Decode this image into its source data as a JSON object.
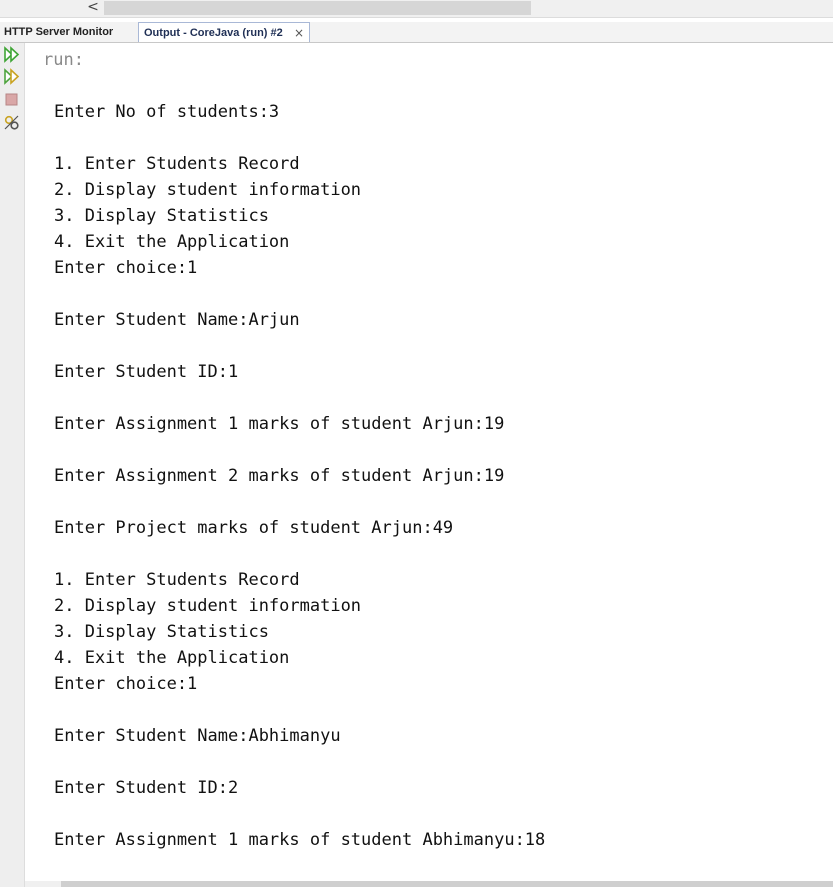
{
  "top_scrollbar": {
    "left_arrow": "<"
  },
  "tabs": [
    {
      "label": "HTTP Server Monitor",
      "active": false
    },
    {
      "label": "Output - CoreJava (run) #2",
      "active": true,
      "close": "×"
    }
  ],
  "toolbar": {
    "icons": [
      "rerun-icon",
      "rerun-with-options-icon",
      "stop-icon",
      "settings-icon"
    ]
  },
  "output": {
    "run_label": "run:",
    "lines": [
      "Enter No of students:3",
      "",
      "1. Enter Students Record",
      "2. Display student information",
      "3. Display Statistics",
      "4. Exit the Application",
      "Enter choice:1",
      "",
      "Enter Student Name:Arjun",
      "",
      "Enter Student ID:1",
      "",
      "Enter Assignment 1 marks of student Arjun:19",
      "",
      "Enter Assignment 2 marks of student Arjun:19",
      "",
      "Enter Project marks of student Arjun:49",
      "",
      "1. Enter Students Record",
      "2. Display student information",
      "3. Display Statistics",
      "4. Exit the Application",
      "Enter choice:1",
      "",
      "Enter Student Name:Abhimanyu",
      "",
      "Enter Student ID:2",
      "",
      "Enter Assignment 1 marks of student Abhimanyu:18"
    ]
  },
  "colors": {
    "run_gray": "#8a8a8a",
    "text": "#111111",
    "rerun_green": "#3fa535",
    "stop_red": "#c98888"
  }
}
